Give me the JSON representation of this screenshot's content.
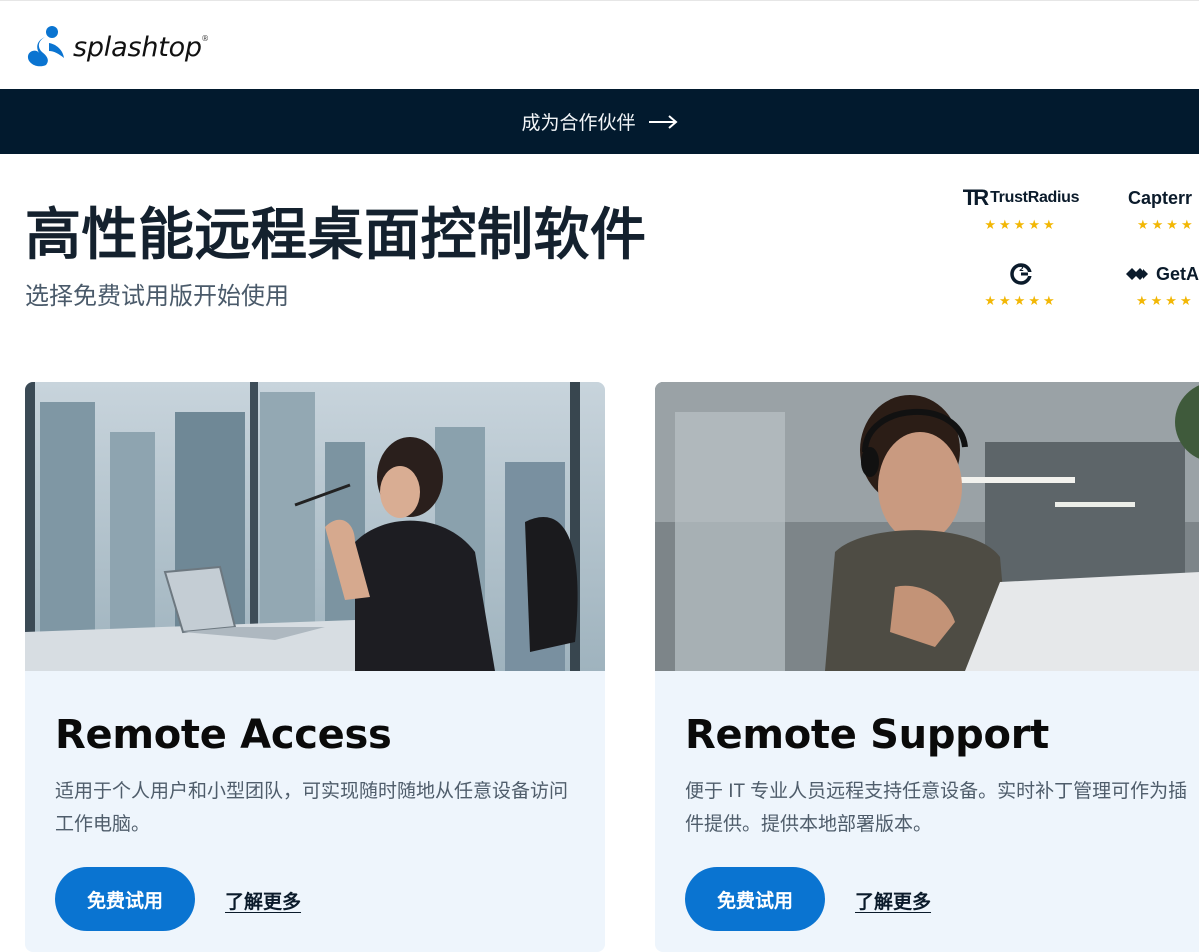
{
  "header": {
    "logo_text": "splashtop",
    "logo_reg": "®"
  },
  "banner": {
    "link_label": "成为合作伙伴",
    "icon": "arrow-right-icon"
  },
  "hero": {
    "title": "高性能远程桌面控制软件",
    "subtitle": "选择免费试用版开始使用"
  },
  "ratings": [
    {
      "name": "TrustRadius",
      "mark": "TR",
      "stars": "★★★★★"
    },
    {
      "name": "Capterra",
      "visible_text": "Capterr",
      "stars": "★★★★"
    },
    {
      "name": "G2",
      "icon": "g2-icon",
      "stars": "★★★★★"
    },
    {
      "name": "GetApp",
      "visible_text": "GetA",
      "icon": "getapp-icon",
      "stars": "★★★★"
    }
  ],
  "cards": [
    {
      "title": "Remote Access",
      "description": "适用于个人用户和小型团队，可实现随时随地从任意设备访问工作电脑。",
      "trial_label": "免费试用",
      "learn_label": "了解更多",
      "image": "woman-at-laptop-office-photo"
    },
    {
      "title": "Remote Support",
      "description": "便于 IT 专业人员远程支持任意设备。实时补丁管理可作为插件提供。提供本地部署版本。",
      "trial_label": "免费试用",
      "learn_label": "了解更多",
      "image": "man-with-headset-photo"
    }
  ],
  "colors": {
    "banner_bg": "#021a2e",
    "accent": "#0a74d1",
    "card_bg": "#eef5fc",
    "star": "#f2b705"
  }
}
